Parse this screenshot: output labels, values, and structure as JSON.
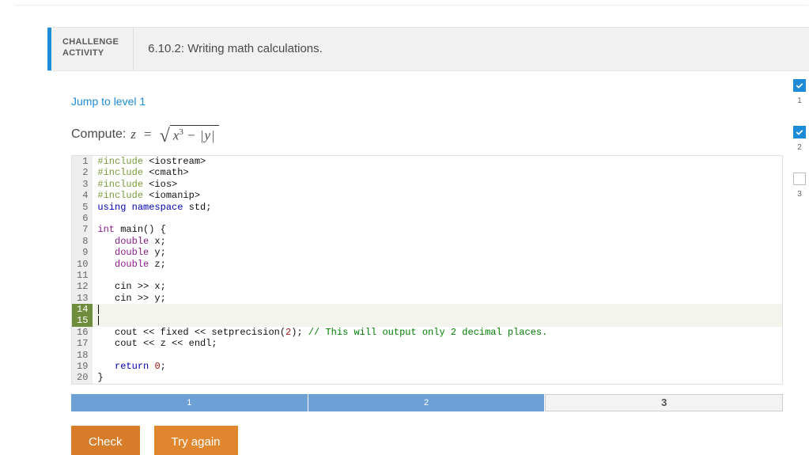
{
  "activity": {
    "kind_line1": "CHALLENGE",
    "kind_line2": "ACTIVITY",
    "title": "6.10.2: Writing math calculations."
  },
  "jump_link": "Jump to level 1",
  "compute": {
    "label": "Compute: ",
    "var": "z",
    "equals": "=",
    "rad_x": "x",
    "rad_exp": "3",
    "rad_minus": " − ",
    "rad_bar1": "|",
    "rad_y": "y",
    "rad_bar2": "|"
  },
  "code": {
    "lines": [
      [
        {
          "cls": "tok-pp",
          "t": "#include "
        },
        {
          "cls": "tok-id",
          "t": "<iostream>"
        }
      ],
      [
        {
          "cls": "tok-pp",
          "t": "#include "
        },
        {
          "cls": "tok-id",
          "t": "<cmath>"
        }
      ],
      [
        {
          "cls": "tok-pp",
          "t": "#include "
        },
        {
          "cls": "tok-id",
          "t": "<ios>"
        }
      ],
      [
        {
          "cls": "tok-pp",
          "t": "#include "
        },
        {
          "cls": "tok-id",
          "t": "<iomanip>"
        }
      ],
      [
        {
          "cls": "tok-kw",
          "t": "using "
        },
        {
          "cls": "tok-kw",
          "t": "namespace"
        },
        {
          "cls": "tok-id",
          "t": " std;"
        }
      ],
      [
        {
          "cls": "tok-id",
          "t": ""
        }
      ],
      [
        {
          "cls": "tok-ty",
          "t": "int"
        },
        {
          "cls": "tok-id",
          "t": " main() {"
        }
      ],
      [
        {
          "cls": "tok-id",
          "t": "   "
        },
        {
          "cls": "tok-ty",
          "t": "double"
        },
        {
          "cls": "tok-id",
          "t": " x;"
        }
      ],
      [
        {
          "cls": "tok-id",
          "t": "   "
        },
        {
          "cls": "tok-ty",
          "t": "double"
        },
        {
          "cls": "tok-id",
          "t": " y;"
        }
      ],
      [
        {
          "cls": "tok-id",
          "t": "   "
        },
        {
          "cls": "tok-ty",
          "t": "double"
        },
        {
          "cls": "tok-id",
          "t": " z;"
        }
      ],
      [
        {
          "cls": "tok-id",
          "t": ""
        }
      ],
      [
        {
          "cls": "tok-id",
          "t": "   cin >> x;"
        }
      ],
      [
        {
          "cls": "tok-id",
          "t": "   cin >> y;"
        }
      ],
      "ACTIVE",
      [
        {
          "cls": "tok-id",
          "t": ""
        }
      ],
      [
        {
          "cls": "tok-id",
          "t": "   cout << fixed << setprecision("
        },
        {
          "cls": "tok-num",
          "t": "2"
        },
        {
          "cls": "tok-id",
          "t": "); "
        },
        {
          "cls": "tok-cm",
          "t": "// This will output only 2 decimal places."
        }
      ],
      [
        {
          "cls": "tok-id",
          "t": "   cout << z << endl;"
        }
      ],
      [
        {
          "cls": "tok-id",
          "t": ""
        }
      ],
      [
        {
          "cls": "tok-id",
          "t": "   "
        },
        {
          "cls": "tok-kw",
          "t": "return"
        },
        {
          "cls": "tok-id",
          "t": " "
        },
        {
          "cls": "tok-num",
          "t": "0"
        },
        {
          "cls": "tok-id",
          "t": ";"
        }
      ],
      [
        {
          "cls": "tok-id",
          "t": "}"
        }
      ]
    ],
    "active_lines": [
      14,
      15
    ]
  },
  "steps": {
    "s1": "1",
    "s2": "2",
    "s3": "3"
  },
  "buttons": {
    "check": "Check",
    "try": "Try again"
  },
  "rail": {
    "n1": "1",
    "n2": "2",
    "n3": "3"
  }
}
